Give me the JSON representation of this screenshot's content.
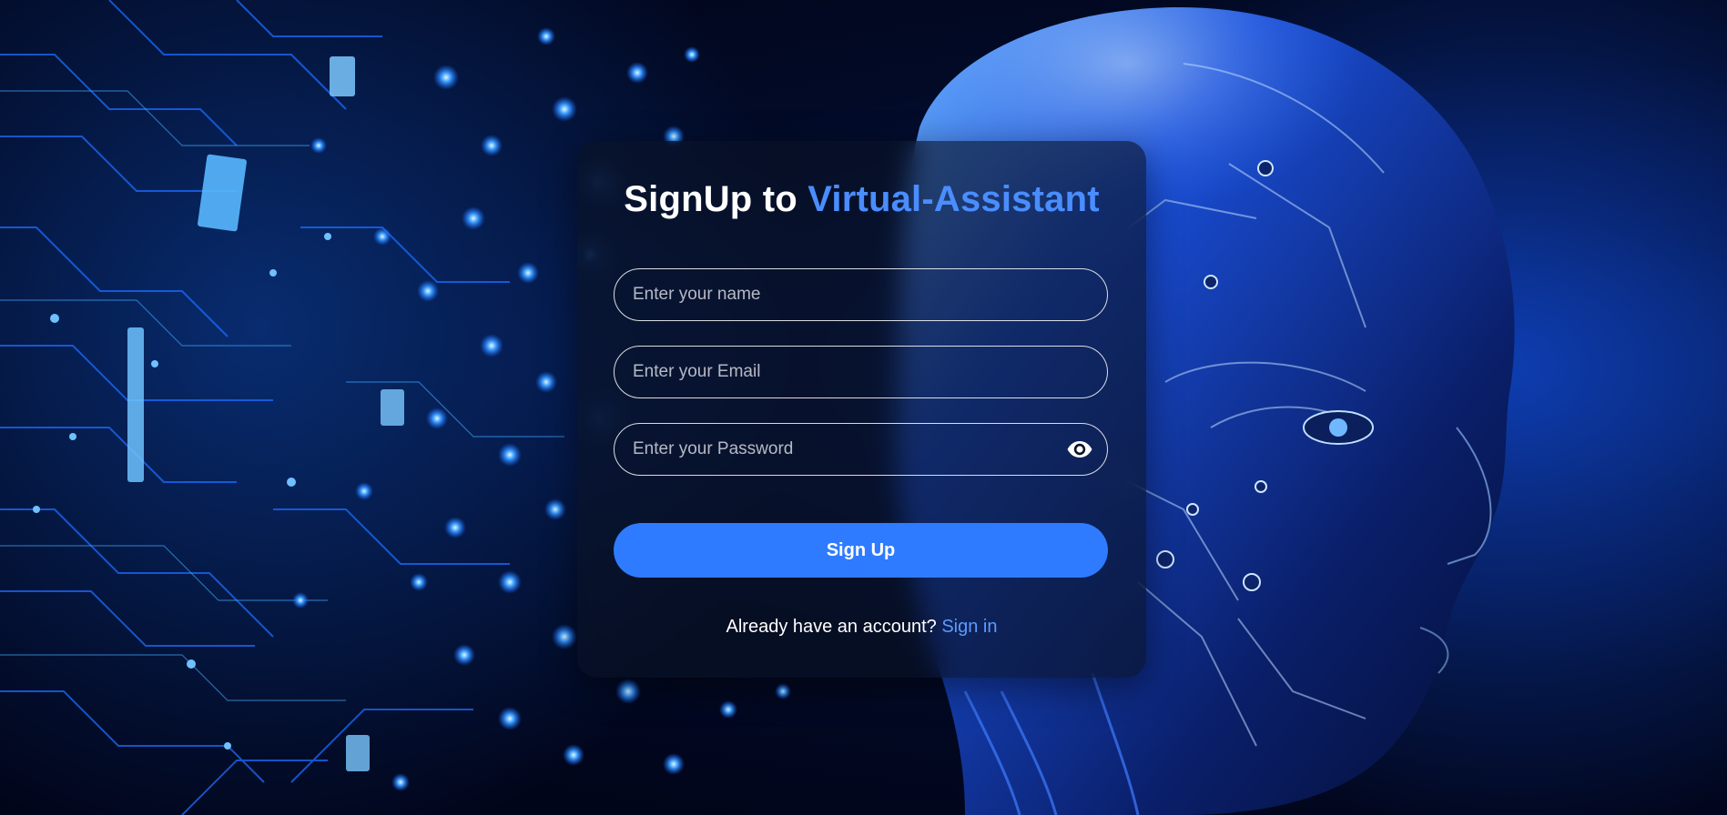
{
  "signup": {
    "title_prefix": "SignUp to ",
    "title_accent": "Virtual-Assistant",
    "name_placeholder": "Enter your name",
    "email_placeholder": "Enter your Email",
    "password_placeholder": "Enter your Password",
    "toggle_password_icon": "eye-icon",
    "submit_label": "Sign Up",
    "footer_text": "Already have an account? ",
    "signin_link": "Sign in"
  },
  "colors": {
    "accent": "#4a8dff",
    "button": "#2f7bff",
    "background": "#020a26"
  }
}
